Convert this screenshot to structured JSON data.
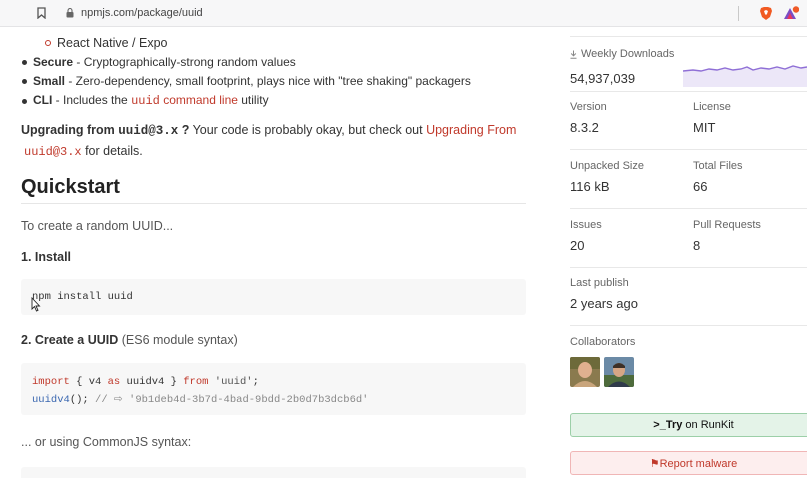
{
  "browser": {
    "url": "npmjs.com/package/uuid"
  },
  "readme": {
    "sub_bullet_link": "React Native / Expo",
    "features": [
      {
        "name": "Secure",
        "desc": " - Cryptographically-strong random values"
      },
      {
        "name": "Small",
        "desc": " - Zero-dependency, small footprint, plays nice with \"tree shaking\" packagers"
      },
      {
        "name": "CLI",
        "desc_before": " - Includes the ",
        "code": "uuid",
        "link": " command line",
        "desc_after": " utility"
      }
    ],
    "upgrading": {
      "bold_prefix": "Upgrading from ",
      "bold_code": "uuid@3.x",
      "bold_suffix": " ?",
      "text": " Your code is probably okay, but check out ",
      "link": "Upgrading From",
      "code2": "uuid@3.x",
      "tail": " for details."
    },
    "heading": "Quickstart",
    "intro": "To create a random UUID...",
    "step1": "1. Install",
    "install_cmd": "npm install uuid",
    "step2_bold": "2. Create a UUID",
    "step2_rest": " (ES6 module syntax)",
    "code_line1": {
      "kw1": "import",
      "mid": " { v4 ",
      "kw2": "as",
      "name": " uuidv4 } ",
      "kw3": "from",
      "str": " 'uuid'",
      "end": ";"
    },
    "code_line2": {
      "fn": "uuidv4",
      "mid": "(); ",
      "comment": "// ⇨ '9b1deb4d-3b7d-4bad-9bdd-2b0d7b3dcb6d'"
    },
    "commonjs": "... or using CommonJS syntax:"
  },
  "sidebar": {
    "weekly_downloads_label": "Weekly Downloads",
    "weekly_downloads": "54,937,039",
    "version_label": "Version",
    "version": "8.3.2",
    "license_label": "License",
    "license": "MIT",
    "unpacked_size_label": "Unpacked Size",
    "unpacked_size": "116 kB",
    "total_files_label": "Total Files",
    "total_files": "66",
    "issues_label": "Issues",
    "issues": "20",
    "pull_requests_label": "Pull Requests",
    "pull_requests": "8",
    "last_publish_label": "Last publish",
    "last_publish": "2 years ago",
    "collaborators_label": "Collaborators",
    "runkit_prefix": ">_",
    "runkit_bold": "Try",
    "runkit_rest": " on RunKit",
    "report_flag": "⚑",
    "report_label": "Report malware"
  },
  "colors": {
    "accent_red": "#c0392b",
    "runkit_green_bg": "#e4f3e8",
    "report_red_bg": "#fdeeee",
    "sparkline": "#8f6fd6"
  }
}
